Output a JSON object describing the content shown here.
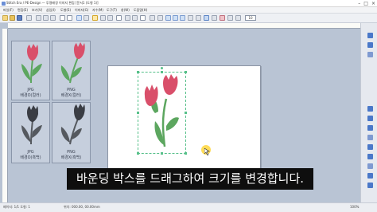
{
  "window": {
    "title": "Stitch Era / PE-Design — 투명배경 이미지 편집 [문서1 (도형 1)]",
    "controls": [
      "–",
      "□",
      "×"
    ]
  },
  "menu": {
    "items": [
      "파일(F)",
      "편집(E)",
      "보기(V)",
      "삽입(I)",
      "도형(S)",
      "이미지(G)",
      "자수(M)",
      "도구(T)",
      "창(W)",
      "도움말(H)"
    ]
  },
  "toolbar": {
    "font_size": "10"
  },
  "thumbnails": [
    {
      "format": "JPG",
      "bg": "배경O(컬러)",
      "style": "color"
    },
    {
      "format": "PNG",
      "bg": "배경X(컬러)",
      "style": "color"
    },
    {
      "format": "JPG",
      "bg": "배경O(흑백)",
      "style": "mono"
    },
    {
      "format": "PNG",
      "bg": "배경X(흑백)",
      "style": "mono"
    }
  ],
  "caption": {
    "text": "바운딩 박스를 드래그하여 크기를 변경합니다."
  },
  "status": {
    "left": "페이지: 1/1   도형: 1",
    "mid": "위치: 000.00, 00.00mm",
    "right": "100%"
  },
  "icons": {
    "tulip_head": "#d94f6a",
    "tulip_leaf": "#5ca65f",
    "mono_head": "#3a3d44",
    "mono_leaf": "#55595f",
    "selection": "#57c08a",
    "accent": "#4a78c9"
  }
}
